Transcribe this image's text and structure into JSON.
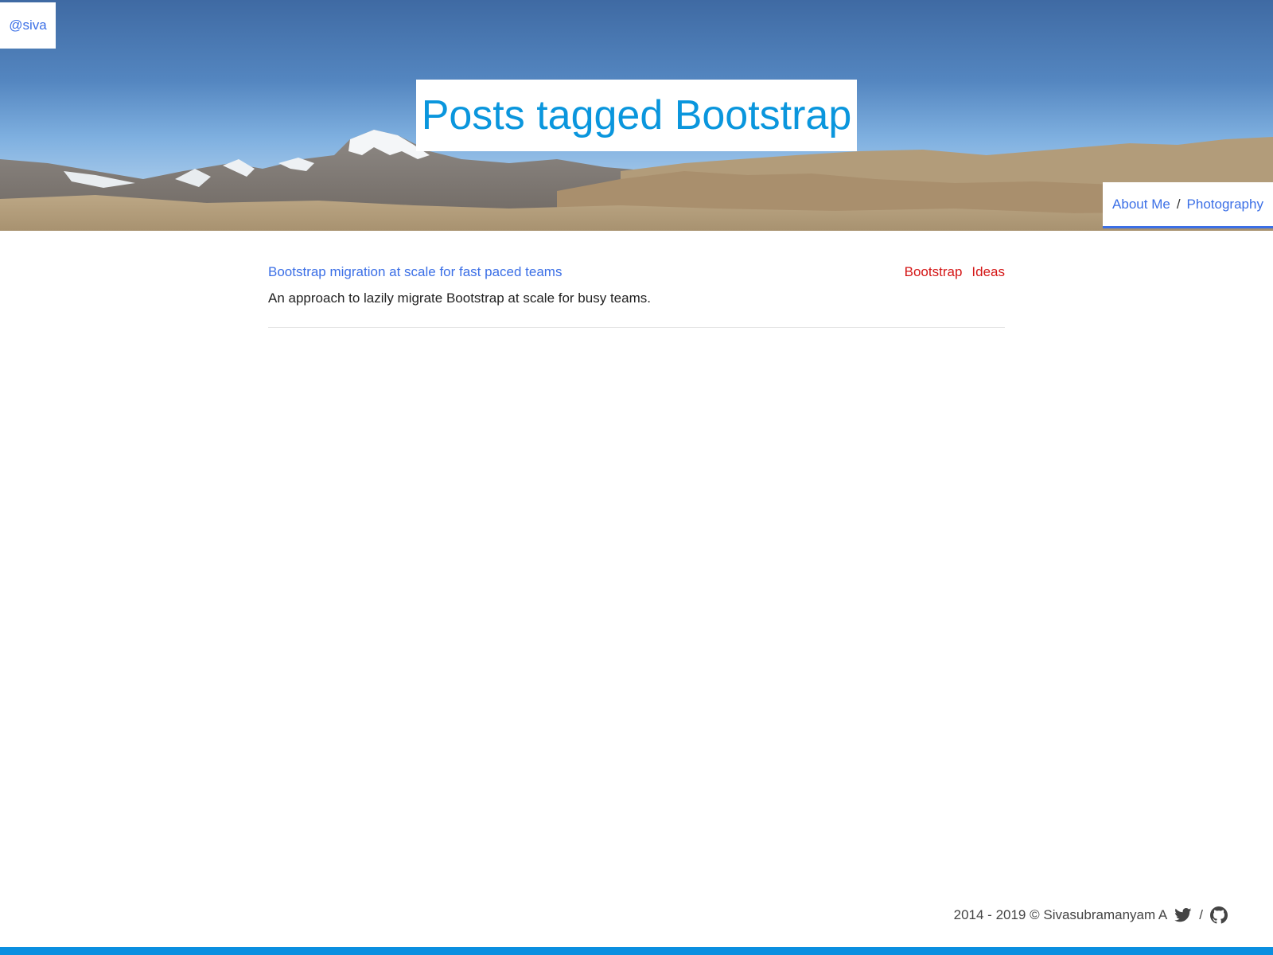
{
  "header": {
    "handle": "@siva",
    "title": "Posts tagged Bootstrap",
    "nav": {
      "about_label": "About Me",
      "separator": "/",
      "photography_label": "Photography"
    }
  },
  "posts": [
    {
      "title": "Bootstrap migration at scale for fast paced teams",
      "summary": "An approach to lazily migrate Bootstrap at scale for busy teams.",
      "tags": [
        "Bootstrap",
        "Ideas"
      ]
    }
  ],
  "footer": {
    "copyright": "2014 - 2019 © Sivasubramanyam A",
    "separator": "/",
    "icons": [
      "twitter-icon",
      "github-icon"
    ]
  },
  "colors": {
    "link": "#3b6fe6",
    "title": "#0a96dd",
    "tag": "#d41616",
    "accent_bar": "#0a8fe0"
  }
}
